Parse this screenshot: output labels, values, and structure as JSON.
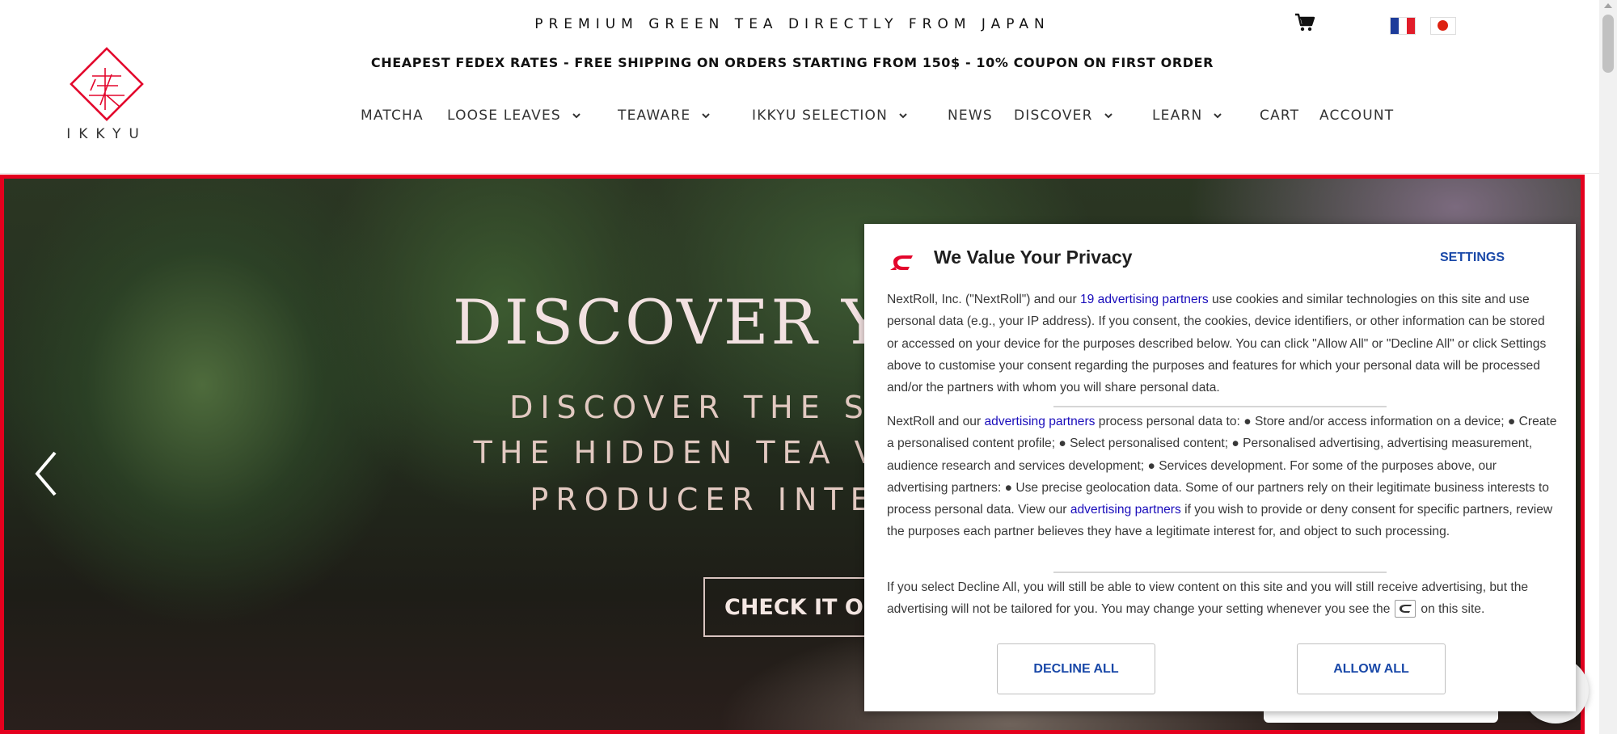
{
  "header": {
    "tagline": "PREMIUM GREEN TEA DIRECTLY FROM JAPAN",
    "shipping_banner": "CHEAPEST FEDEX RATES - FREE SHIPPING ON ORDERS STARTING FROM 150$ - 10% COUPON ON FIRST ORDER",
    "logo_text": "IKKYU",
    "icons": {
      "cart": "cart-icon",
      "french_flag": "flag-fr-icon",
      "japanese_flag": "flag-jp-icon"
    }
  },
  "nav": {
    "items": [
      {
        "label": "MATCHA",
        "dropdown": false
      },
      {
        "label": "LOOSE LEAVES",
        "dropdown": true
      },
      {
        "label": "TEAWARE",
        "dropdown": true
      },
      {
        "label": "IKKYU SELECTION",
        "dropdown": true
      },
      {
        "label": "NEWS",
        "dropdown": false
      },
      {
        "label": "DISCOVER",
        "dropdown": true
      },
      {
        "label": "LEARN",
        "dropdown": true
      },
      {
        "label": "CART",
        "dropdown": false
      },
      {
        "label": "ACCOUNT",
        "dropdown": false
      }
    ]
  },
  "hero": {
    "title": "DISCOVER YA",
    "subtitle_lines": [
      "DISCOVER THE SE",
      "THE HIDDEN TEA VAL",
      "PRODUCER INTE"
    ],
    "cta_label": "CHECK IT OU",
    "prev_icon": "chevron-left-icon"
  },
  "consent": {
    "title": "We Value Your Privacy",
    "settings_label": "SETTINGS",
    "p1_a": "NextRoll, Inc. (\"NextRoll\") and our ",
    "p1_link": "19 advertising partners",
    "p1_b": " use cookies and similar technologies on this site and use personal data (e.g., your IP address). If you consent, the cookies, device identifiers, or other information can be stored or accessed on your device for the purposes described below. You can click \"Allow All\" or \"Decline All\" or click Settings above to customise your consent regarding the purposes and features for which your personal data will be processed and/or the partners with whom you will share personal data.",
    "p2_a": "NextRoll and our ",
    "p2_link1": "advertising partners",
    "p2_b": " process personal data to: ● Store and/or access information on a device; ● Create a personalised content profile; ● Select personalised content; ● Personalised advertising, advertising measurement, audience research and services development; ● Services development. For some of the purposes above, our advertising partners: ● Use precise geolocation data. Some of our partners rely on their legitimate business interests to process personal data. View our ",
    "p2_link2": "advertising partners",
    "p2_c": " if you wish to provide or deny consent for specific partners, review the purposes each partner believes they have a legitimate interest for, and object to such processing.",
    "p3_a": "If you select Decline All, you will still be able to view content on this site and you will still receive advertising, but the advertising will not be tailored for you. You may change your setting whenever you see the",
    "p3_b": "on this site.",
    "decline_label": "DECLINE ALL",
    "allow_label": "ALLOW ALL",
    "brand_color": "#e3062c",
    "link_color": "#1a0dbb"
  }
}
